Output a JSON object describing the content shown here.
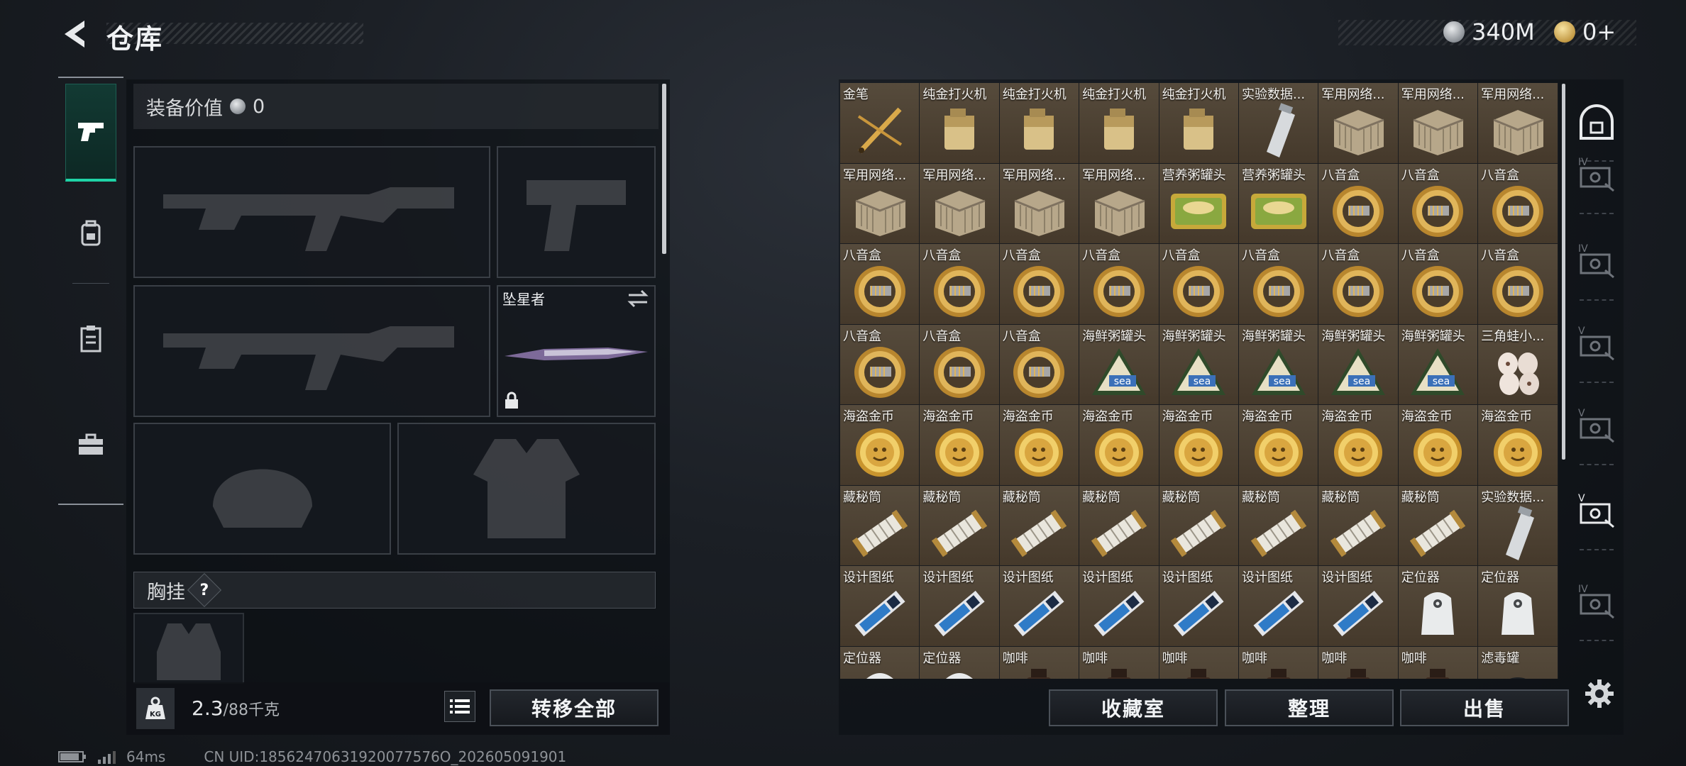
{
  "header": {
    "title": "仓库",
    "back_icon": "back-arrow-icon"
  },
  "currency": [
    {
      "icon": "silver-coin-icon",
      "amount": "340M"
    },
    {
      "icon": "gold-coin-icon",
      "amount": "0+"
    }
  ],
  "left_nav": [
    {
      "name": "weapons",
      "icon": "pistol-icon",
      "active": true
    },
    {
      "name": "gear",
      "icon": "backpack-lock-icon",
      "active": false
    },
    {
      "name": "clipboard",
      "icon": "clipboard-icon",
      "active": false
    },
    {
      "name": "toolbox",
      "icon": "toolbox-icon",
      "active": false
    }
  ],
  "equipment": {
    "value_label": "装备价值",
    "value_amount": "0",
    "melee_slot_label": "坠星者",
    "chest_rig_label": "胸挂",
    "chest_help": "?"
  },
  "footer_left": {
    "weight_current": "2.3",
    "weight_max": "/88千克",
    "transfer_all": "转移全部"
  },
  "footer_right": {
    "collection": "收藏室",
    "organize": "整理",
    "sell": "出售"
  },
  "stash_items": [
    {
      "name": "金笔",
      "kind": "pen"
    },
    {
      "name": "纯金打火机",
      "kind": "lighter"
    },
    {
      "name": "纯金打火机",
      "kind": "lighter"
    },
    {
      "name": "纯金打火机",
      "kind": "lighter"
    },
    {
      "name": "纯金打火机",
      "kind": "lighter"
    },
    {
      "name": "实验数据...",
      "kind": "usb"
    },
    {
      "name": "军用网络...",
      "kind": "box"
    },
    {
      "name": "军用网络...",
      "kind": "box"
    },
    {
      "name": "军用网络...",
      "kind": "box"
    },
    {
      "name": "军用网络...",
      "kind": "box"
    },
    {
      "name": "军用网络...",
      "kind": "box"
    },
    {
      "name": "军用网络...",
      "kind": "box"
    },
    {
      "name": "军用网络...",
      "kind": "box"
    },
    {
      "name": "营养粥罐头",
      "kind": "tin"
    },
    {
      "name": "营养粥罐头",
      "kind": "tin"
    },
    {
      "name": "八音盒",
      "kind": "musicbox"
    },
    {
      "name": "八音盒",
      "kind": "musicbox"
    },
    {
      "name": "八音盒",
      "kind": "musicbox"
    },
    {
      "name": "八音盒",
      "kind": "musicbox"
    },
    {
      "name": "八音盒",
      "kind": "musicbox"
    },
    {
      "name": "八音盒",
      "kind": "musicbox"
    },
    {
      "name": "八音盒",
      "kind": "musicbox"
    },
    {
      "name": "八音盒",
      "kind": "musicbox"
    },
    {
      "name": "八音盒",
      "kind": "musicbox"
    },
    {
      "name": "八音盒",
      "kind": "musicbox"
    },
    {
      "name": "八音盒",
      "kind": "musicbox"
    },
    {
      "name": "八音盒",
      "kind": "musicbox"
    },
    {
      "name": "八音盒",
      "kind": "musicbox"
    },
    {
      "name": "八音盒",
      "kind": "musicbox"
    },
    {
      "name": "八音盒",
      "kind": "musicbox"
    },
    {
      "name": "海鲜粥罐头",
      "kind": "seacan"
    },
    {
      "name": "海鲜粥罐头",
      "kind": "seacan"
    },
    {
      "name": "海鲜粥罐头",
      "kind": "seacan"
    },
    {
      "name": "海鲜粥罐头",
      "kind": "seacan"
    },
    {
      "name": "海鲜粥罐头",
      "kind": "seacan"
    },
    {
      "name": "三角蛙小...",
      "kind": "eggs"
    },
    {
      "name": "海盗金币",
      "kind": "coin"
    },
    {
      "name": "海盗金币",
      "kind": "coin"
    },
    {
      "name": "海盗金币",
      "kind": "coin"
    },
    {
      "name": "海盗金币",
      "kind": "coin"
    },
    {
      "name": "海盗金币",
      "kind": "coin"
    },
    {
      "name": "海盗金币",
      "kind": "coin"
    },
    {
      "name": "海盗金币",
      "kind": "coin"
    },
    {
      "name": "海盗金币",
      "kind": "coin"
    },
    {
      "name": "海盗金币",
      "kind": "coin"
    },
    {
      "name": "藏秘筒",
      "kind": "cryptex"
    },
    {
      "name": "藏秘筒",
      "kind": "cryptex"
    },
    {
      "name": "藏秘筒",
      "kind": "cryptex"
    },
    {
      "name": "藏秘筒",
      "kind": "cryptex"
    },
    {
      "name": "藏秘筒",
      "kind": "cryptex"
    },
    {
      "name": "藏秘筒",
      "kind": "cryptex"
    },
    {
      "name": "藏秘筒",
      "kind": "cryptex"
    },
    {
      "name": "藏秘筒",
      "kind": "cryptex"
    },
    {
      "name": "实验数据...",
      "kind": "usb"
    },
    {
      "name": "设计图纸",
      "kind": "blueprint"
    },
    {
      "name": "设计图纸",
      "kind": "blueprint"
    },
    {
      "name": "设计图纸",
      "kind": "blueprint"
    },
    {
      "name": "设计图纸",
      "kind": "blueprint"
    },
    {
      "name": "设计图纸",
      "kind": "blueprint"
    },
    {
      "name": "设计图纸",
      "kind": "blueprint"
    },
    {
      "name": "设计图纸",
      "kind": "blueprint"
    },
    {
      "name": "定位器",
      "kind": "tracker"
    },
    {
      "name": "定位器",
      "kind": "tracker"
    },
    {
      "name": "定位器",
      "kind": "tracker"
    },
    {
      "name": "定位器",
      "kind": "tracker"
    },
    {
      "name": "咖啡",
      "kind": "coffee"
    },
    {
      "name": "咖啡",
      "kind": "coffee"
    },
    {
      "name": "咖啡",
      "kind": "coffee"
    },
    {
      "name": "咖啡",
      "kind": "coffee"
    },
    {
      "name": "咖啡",
      "kind": "coffee"
    },
    {
      "name": "咖啡",
      "kind": "coffee"
    },
    {
      "name": "滤毒罐",
      "kind": "filter"
    }
  ],
  "right_tabs": [
    {
      "icon": "vault-icon",
      "label": ""
    },
    {
      "icon": "case-icon",
      "label": "IV"
    },
    {
      "icon": "case-icon",
      "label": "IV"
    },
    {
      "icon": "case-icon",
      "label": "V"
    },
    {
      "icon": "case-icon",
      "label": "V"
    },
    {
      "icon": "case-icon",
      "label": "V"
    },
    {
      "icon": "case-icon",
      "label": "IV"
    }
  ],
  "status": {
    "ping": "64ms",
    "uid": "CN UID:18562470631920077576O_202605091901"
  }
}
